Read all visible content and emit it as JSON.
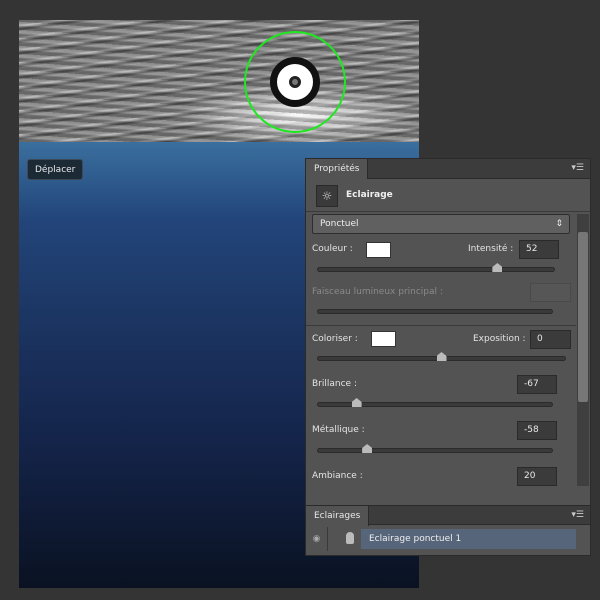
{
  "tooltip": "Déplacer",
  "properties": {
    "tab": "Propriétés",
    "adjustment_title": "Eclairage",
    "light_type": "Ponctuel",
    "color_label": "Couleur :",
    "color_value": "#ffffff",
    "intensity_label": "Intensité :",
    "intensity": "52",
    "intensity_fraction": 0.76,
    "hotspot_label": "Faisceau lumineux principal :",
    "colorize_label": "Coloriser :",
    "colorize_value": "#ffffff",
    "exposure_label": "Exposition :",
    "exposure": "0",
    "exposure_fraction": 0.5,
    "gloss_label": "Brillance :",
    "gloss": "-67",
    "gloss_fraction": 0.165,
    "metallic_label": "Métallique :",
    "metallic": "-58",
    "metallic_fraction": 0.21,
    "ambience_label": "Ambiance :",
    "ambience": "20"
  },
  "lights": {
    "tab": "Eclairages",
    "items": [
      {
        "label": "Eclairage ponctuel 1"
      }
    ]
  },
  "colors": {
    "target_ring": "#1ee81e",
    "selection": "#56657a"
  }
}
